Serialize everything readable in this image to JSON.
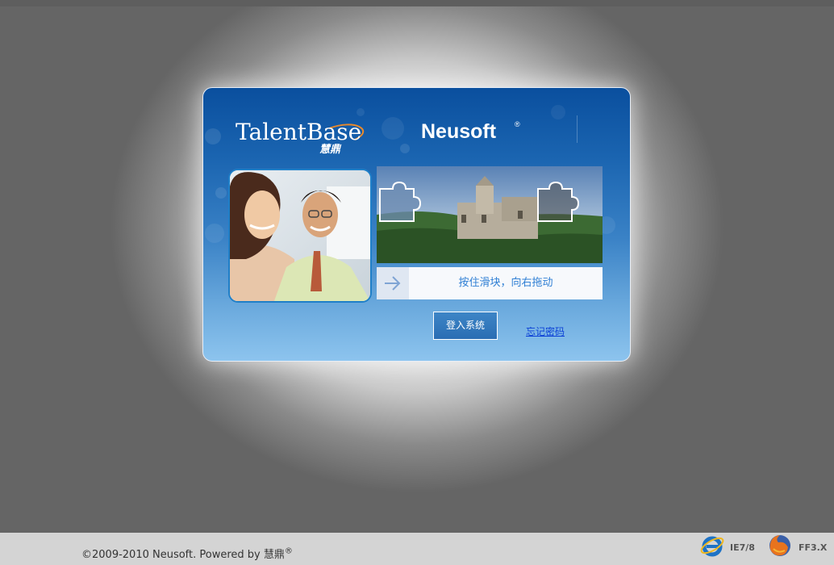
{
  "header": {
    "brand_logo": "TalentBase",
    "brand_logo_cn": "慧鼎",
    "partner_logo": "Neusoft",
    "registered_mark": "®"
  },
  "captcha": {
    "slider_hint": "按住滑块，向右拖动",
    "slider_icon": "arrow-right-icon",
    "progress": 0
  },
  "actions": {
    "login_label": "登入系统",
    "forgot_password_label": "忘记密码"
  },
  "footer": {
    "copyright_text": "©2009-2010 Neusoft. Powered by 慧鼎",
    "copyright_mark": "®",
    "browsers": [
      {
        "icon": "internet-explorer-icon",
        "label": "IE7/8"
      },
      {
        "icon": "firefox-icon",
        "label": "FF3.X"
      }
    ]
  },
  "colors": {
    "card_top": "#0a4f9e",
    "card_bottom": "#8dc4ee",
    "slider_text": "#2f7fd4",
    "link": "#0a3fd6",
    "footer_bg": "#d4d4d4"
  }
}
